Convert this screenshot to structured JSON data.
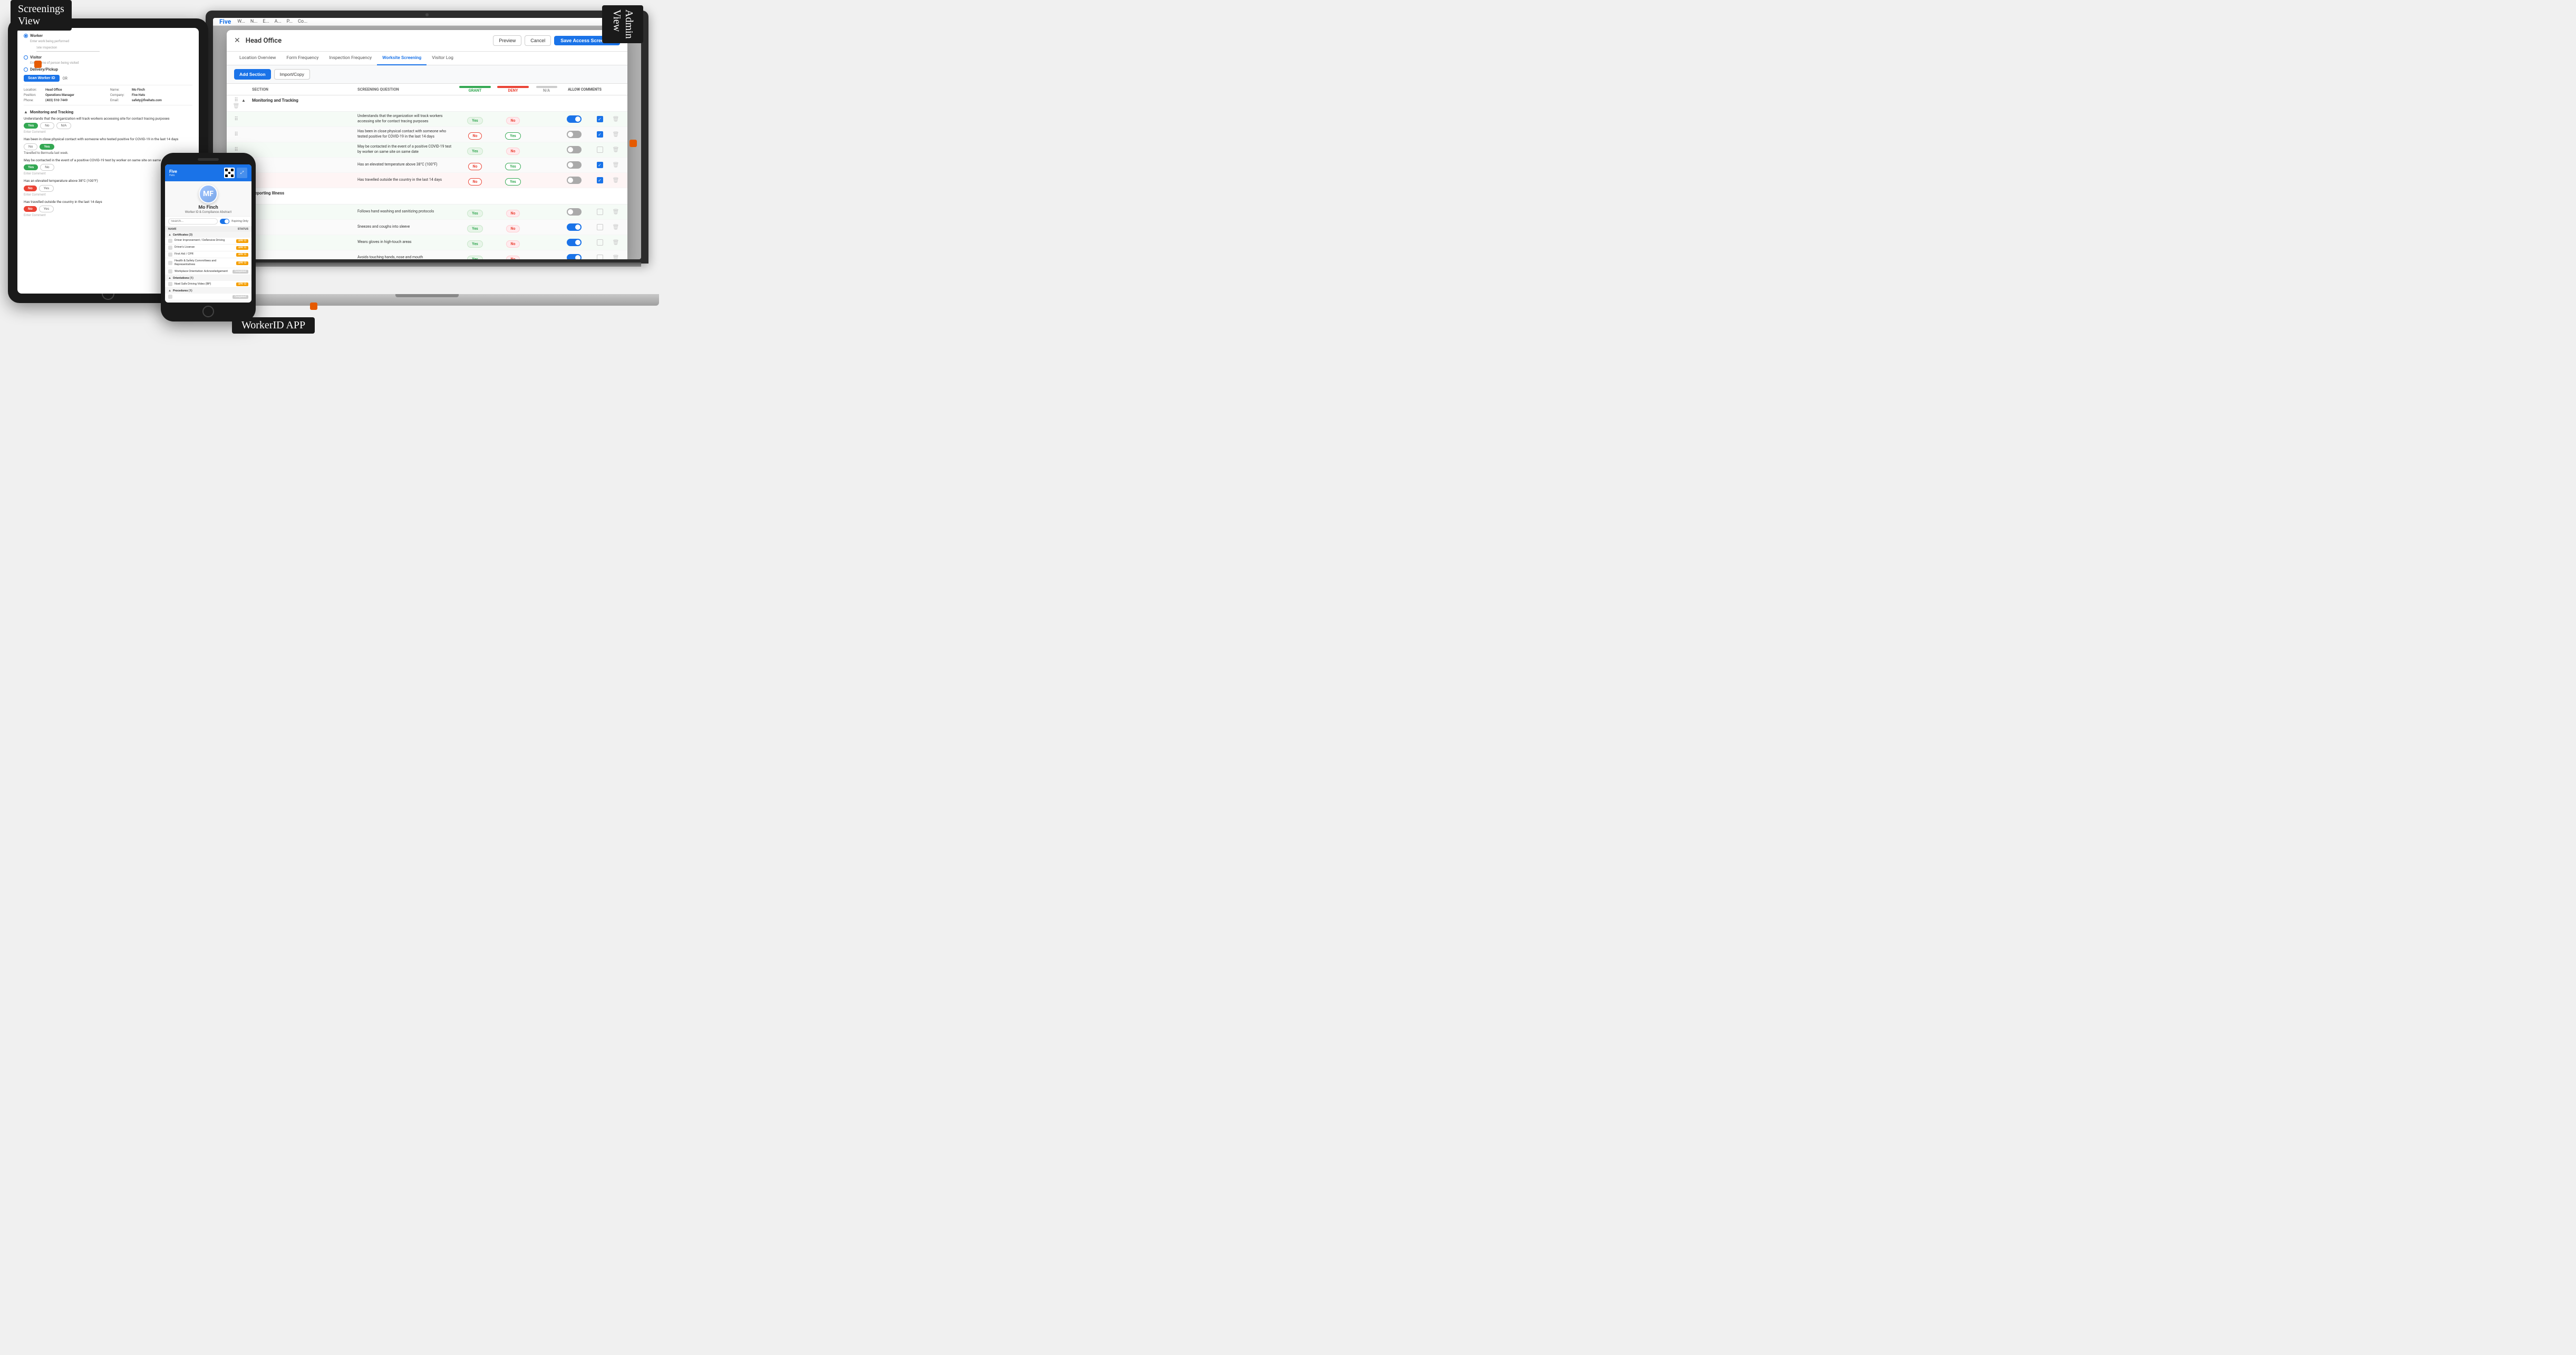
{
  "labels": {
    "screenings_view": "Screenings\nView",
    "admin_view": "Admin\nView",
    "workerid_app": "WorkerID APP"
  },
  "tablet": {
    "radio_worker": "Worker",
    "radio_worker_sub": "Enter work being performed",
    "input_placeholder": "Site Inspection",
    "radio_visitor": "Visitor",
    "radio_visitor_placeholder": "Enter name of person being visited",
    "radio_delivery": "Delivery/Pickup",
    "scan_btn": "Scan Worker ID",
    "or": "OR",
    "location_label": "Location:",
    "location_value": "Head Office",
    "name_label": "Name:",
    "name_value": "Mo Finch",
    "position_label": "Position:",
    "position_value": "Operations Manager",
    "company_label": "Company:",
    "company_value": "Five Hats",
    "phone_label": "Phone:",
    "phone_value": "(403) 510-7449",
    "email_label": "Email:",
    "email_value": "safety@fivehats.com",
    "section_monitoring": "Monitoring and Tracking",
    "q1": "Understands that the organization will track workers accessing site for contact tracing purposes",
    "q1_yes": "Yes",
    "q1_no": "No",
    "q1_na": "N/A",
    "q1_comment": "Enter Comment",
    "q2": "Has been in close physical contact with someone who tested positive for COVID-19 in the last 14 days",
    "q2_no": "No",
    "q2_yes": "Yes",
    "q2_comment": "Travelled to Bermuda last week.",
    "q3": "May be contacted in the event of a positive COVID-19 test by worker on same site on same date",
    "q3_yes": "Yes",
    "q3_no": "No",
    "q3_comment": "Enter Comment",
    "q4": "Has an elevated temperature above 38°C (100°F)",
    "q4_no": "No",
    "q4_yes": "Yes",
    "q4_comment": "Enter Comment",
    "q5": "Has travelled outside the country in the last 14 days",
    "q5_no": "No",
    "q5_yes": "Yes",
    "q5_comment": "Enter Comment"
  },
  "phone": {
    "header_logo": "Five Hats",
    "worker_id_title": "Worker ID & Compliance Abstract",
    "avatar_initials": "MF",
    "name": "Mo Finch",
    "toggle_label": "Expiring Only",
    "name_col": "NAME",
    "status_col": "STATUS",
    "section_certs": "Certificates (3)",
    "cert1": "Driver Improvement / Defensive Driving",
    "cert1_badge": "APR 13",
    "cert2": "Driver's License",
    "cert2_badge": "APR 13",
    "cert3": "First Aid / CPR",
    "cert3_badge": "APR 13",
    "cert4": "Health & Safety Committees and Representatives",
    "cert4_badge": "APR 13",
    "cert5": "Workplace Orientation Acknowledgement",
    "cert5_badge": "Completed",
    "section_orientations": "Orientations (1)",
    "orient1": "Noel Safe Driving Video (BP)",
    "orient1_badge": "APR 13",
    "section_procedures": "Procedures (1)",
    "proc_badge": "Completed"
  },
  "modal": {
    "close_icon": "✕",
    "title": "Head Office",
    "btn_preview": "Preview",
    "btn_cancel": "Cancel",
    "btn_save": "Save Access Screening",
    "tab_location": "Location Overview",
    "tab_frequency": "Form Frequency",
    "tab_inspection": "Inspection Frequency",
    "tab_worksite": "Worksite Screening",
    "tab_visitor": "Visitor Log",
    "btn_add_section": "Add Section",
    "btn_import": "Import/Copy",
    "col_section": "SECTION",
    "col_question": "SCREENING QUESTION",
    "col_grant": "GRANT",
    "col_deny": "DENY",
    "col_na": "N/A",
    "col_comments": "ALLOW COMMENTS",
    "section1": "Monitoring and Tracking",
    "section2": "Reporting Illness",
    "questions": [
      {
        "text": "Understands that the organization will track workers accessing site for contact tracing purposes",
        "grant": "Yes",
        "deny": "No",
        "toggle": "on",
        "checkbox": "checked"
      },
      {
        "text": "Has been in close physical contact with someone who tested positive for COVID-19 in the last 14 days",
        "grant": "No",
        "deny": "Yes",
        "toggle": "off",
        "checkbox": "checked"
      },
      {
        "text": "May be contacted in the event of a positive COVID-19 test by worker on same site on same date",
        "grant": "Yes",
        "deny": "No",
        "toggle": "off",
        "checkbox": "unchecked"
      },
      {
        "text": "Has an elevated temperature above 38°C (100°F)",
        "grant": "No",
        "deny": "Yes",
        "toggle": "off",
        "checkbox": "checked"
      },
      {
        "text": "Has travelled outside the country in the last 14 days",
        "grant": "No",
        "deny": "Yes",
        "toggle": "off",
        "checkbox": "checked"
      },
      {
        "text": "Follows hand washing and sanitizing protocols",
        "grant": "Yes",
        "deny": "No",
        "toggle": "off",
        "checkbox": "unchecked"
      },
      {
        "text": "Sneezes and coughs into sleeve",
        "grant": "Yes",
        "deny": "No",
        "toggle": "on",
        "checkbox": "unchecked"
      },
      {
        "text": "Wears gloves in high-touch areas",
        "grant": "Yes",
        "deny": "No",
        "toggle": "on",
        "checkbox": "unchecked"
      },
      {
        "text": "Avoids touching hands, nose and mouth",
        "grant": "Yes",
        "deny": "No",
        "toggle": "on",
        "checkbox": "unchecked"
      }
    ]
  }
}
